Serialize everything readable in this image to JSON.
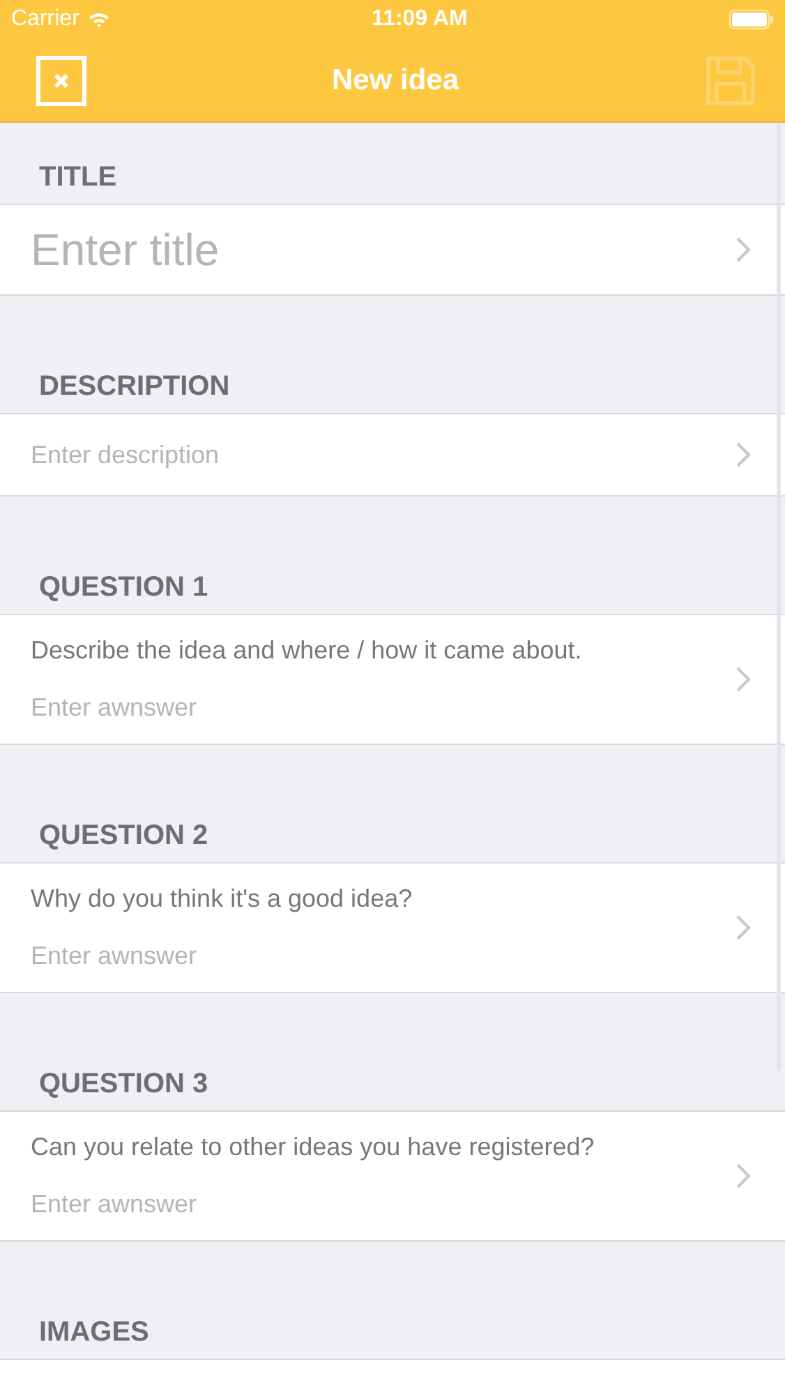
{
  "status_bar": {
    "carrier": "Carrier",
    "time": "11:09 AM"
  },
  "nav": {
    "title": "New idea",
    "save_disabled": true
  },
  "sections": [
    {
      "kind": "title",
      "header": "TITLE",
      "placeholder": "Enter title"
    },
    {
      "kind": "field",
      "header": "DESCRIPTION",
      "placeholder": "Enter description"
    },
    {
      "kind": "question",
      "header": "QUESTION 1",
      "question": "Describe the idea and where / how it came about.",
      "placeholder": "Enter awnswer"
    },
    {
      "kind": "question",
      "header": "QUESTION 2",
      "question": "Why do you think it's a good idea?",
      "placeholder": "Enter awnswer"
    },
    {
      "kind": "question",
      "header": "QUESTION 3",
      "question": "Can you relate to other ideas you have registered?",
      "placeholder": "Enter awnswer"
    },
    {
      "kind": "images",
      "header": "IMAGES"
    }
  ]
}
